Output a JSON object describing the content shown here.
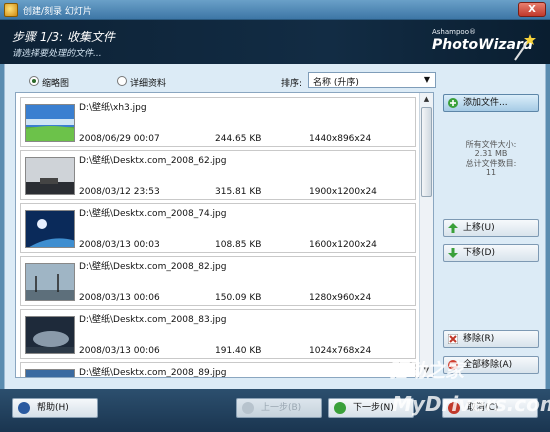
{
  "window": {
    "title": "创建/刻录 幻灯片",
    "close_label": "X"
  },
  "header": {
    "step_title": "步骤 1/3: 收集文件",
    "step_subtitle": "请选择要处理的文件...",
    "brand_small": "Ashampoo®",
    "brand_big": "PhotoWizard"
  },
  "view_options": {
    "thumbnails_label": "缩略图",
    "details_label": "详细资料",
    "selected": "thumbnails",
    "sort_label": "排序:",
    "sort_value": "名称 (升序)"
  },
  "files": [
    {
      "path": "D:\\壁纸\\xh3.jpg",
      "date": "2008/06/29 00:07",
      "size": "244.65 KB",
      "dimensions": "1440x896x24"
    },
    {
      "path": "D:\\壁纸\\Desktx.com_2008_62.jpg",
      "date": "2008/03/12 23:53",
      "size": "315.81 KB",
      "dimensions": "1900x1200x24"
    },
    {
      "path": "D:\\壁纸\\Desktx.com_2008_74.jpg",
      "date": "2008/03/13 00:03",
      "size": "108.85 KB",
      "dimensions": "1600x1200x24"
    },
    {
      "path": "D:\\壁纸\\Desktx.com_2008_82.jpg",
      "date": "2008/03/13 00:06",
      "size": "150.09 KB",
      "dimensions": "1280x960x24"
    },
    {
      "path": "D:\\壁纸\\Desktx.com_2008_83.jpg",
      "date": "2008/03/13 00:06",
      "size": "191.40 KB",
      "dimensions": "1024x768x24"
    },
    {
      "path": "D:\\壁纸\\Desktx.com_2008_89.jpg",
      "date": "",
      "size": "",
      "dimensions": ""
    }
  ],
  "sidebar": {
    "add_files_label": "添加文件...",
    "total_size_label": "所有文件大小:",
    "total_size_value": "2.31 MB",
    "total_count_label": "总计文件数目:",
    "total_count_value": "11",
    "move_up_label": "上移(U)",
    "move_down_label": "下移(D)",
    "remove_label": "移除(R)",
    "remove_all_label": "全部移除(A)"
  },
  "footer": {
    "help_label": "帮助(H)",
    "back_label": "上一步(B)",
    "next_label": "下一步(N)",
    "cancel_label": "取消(C)"
  },
  "watermark": {
    "line1": "驱动之家",
    "line2": "MyDrivers.com"
  },
  "colors": {
    "header_bg": "#0d2236",
    "client_bg": "#dcebf6",
    "accent_green": "#3aa03a"
  }
}
